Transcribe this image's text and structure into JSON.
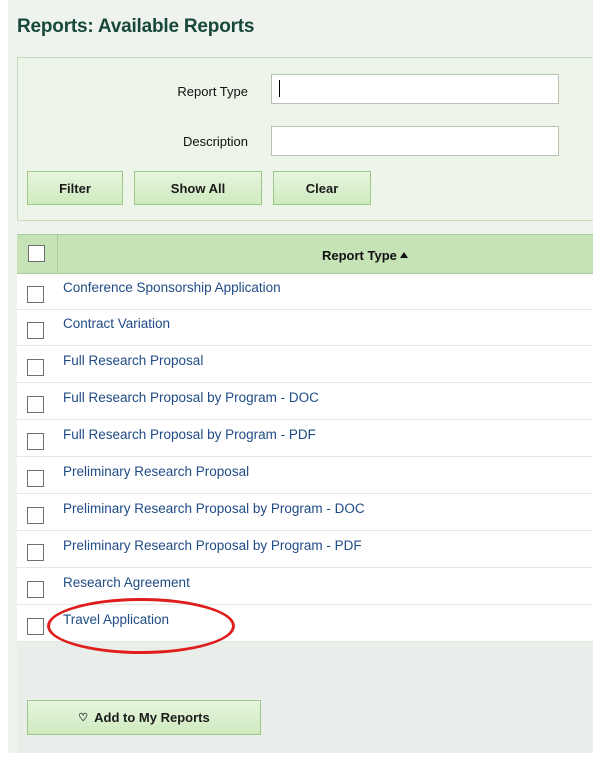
{
  "page": {
    "title": "Reports: Available Reports"
  },
  "filter": {
    "report_type_label": "Report Type",
    "report_type_value": "",
    "description_label": "Description",
    "description_value": "",
    "buttons": {
      "filter": "Filter",
      "show_all": "Show All",
      "clear": "Clear"
    }
  },
  "table": {
    "header": "Report Type",
    "sort": "ascending",
    "rows": [
      "Conference Sponsorship Application",
      "Contract Variation",
      "Full Research Proposal",
      "Full Research Proposal by Program - DOC",
      "Full Research Proposal by Program - PDF",
      "Preliminary Research Proposal",
      "Preliminary Research Proposal by Program - DOC",
      "Preliminary Research Proposal by Program - PDF",
      "Research Agreement",
      "Travel Application"
    ]
  },
  "actions": {
    "add_to_my_reports": "Add to My Reports"
  },
  "colors": {
    "title": "#17483a",
    "link": "#1f4b86",
    "header_bg": "#c5e3b6",
    "button_bg": "#d8efcb",
    "highlight": "#e01d1d"
  },
  "icons": {
    "add_button_icon": "heart-outline-icon",
    "sort_icon": "sort-ascending-icon"
  }
}
